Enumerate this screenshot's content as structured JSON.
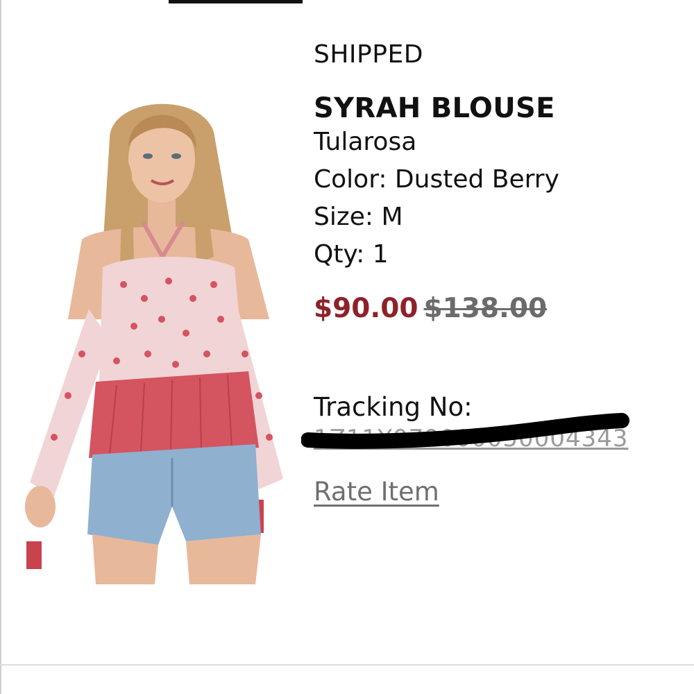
{
  "order": {
    "status": "SHIPPED",
    "item": {
      "name": "SYRAH BLOUSE",
      "brand": "Tularosa",
      "color": "Color: Dusted Berry",
      "size": "Size: M",
      "qty": "Qty: 1",
      "sale_price": "$90.00",
      "original_price": "$138.00"
    },
    "tracking": {
      "label": "Tracking No:",
      "number_visible_fragment": "1Z11Y079000050004343"
    },
    "rate_link": "Rate Item"
  },
  "colors": {
    "sale_price": "#8e2229",
    "original_price": "#6b6b6b",
    "link": "#6f6f6f",
    "divider": "#dcdcdc",
    "blouse": "#d4545f"
  }
}
